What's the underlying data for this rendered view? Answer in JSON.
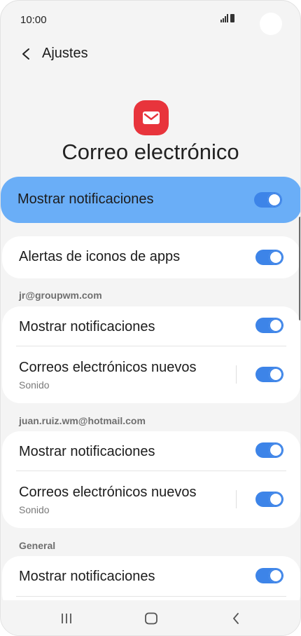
{
  "status_bar": {
    "time": "10:00"
  },
  "header": {
    "back_label": "Ajustes",
    "app_title": "Correo electrónico"
  },
  "main_toggle": {
    "label": "Mostrar notificaciones",
    "on": true
  },
  "badges_card": {
    "label": "Alertas de iconos de apps",
    "on": true
  },
  "accounts": [
    {
      "email": "jr@groupwm.com",
      "show_label": "Mostrar notificaciones",
      "new_mail_label": "Correos electrónicos nuevos",
      "new_mail_sub": "Sonido"
    },
    {
      "email": "juan.ruiz.wm@hotmail.com",
      "show_label": "Mostrar notificaciones",
      "new_mail_label": "Correos electrónicos nuevos",
      "new_mail_sub": "Sonido"
    }
  ],
  "general": {
    "section": "General",
    "show_label": "Mostrar notificaciones"
  },
  "nav": {
    "recents": "recents-icon",
    "home": "home-icon",
    "back": "back-icon"
  },
  "colors": {
    "accent": "#3d84e8",
    "highlight": "#6aaef7",
    "app_icon": "#e8343c"
  }
}
